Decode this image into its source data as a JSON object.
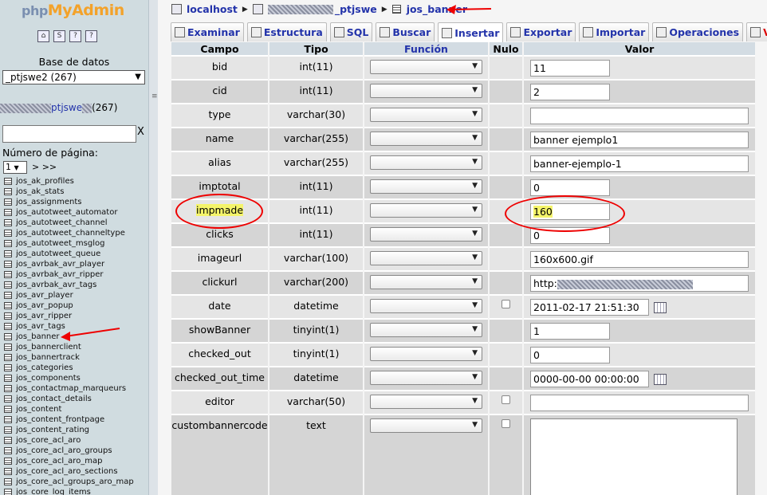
{
  "left": {
    "logo": {
      "php": "php",
      "my": "MyAdmin"
    },
    "db_label": "Base de datos",
    "db_select": "_ptjswe2 (267)",
    "db_name_visible": "ptjswe",
    "db_count": "(267)",
    "filter_clear": "X",
    "page_label": "Número de página:",
    "page_value": "1",
    "page_nav": "> >>",
    "tables": [
      "jos_ak_profiles",
      "jos_ak_stats",
      "jos_assignments",
      "jos_autotweet_automator",
      "jos_autotweet_channel",
      "jos_autotweet_channeltype",
      "jos_autotweet_msglog",
      "jos_autotweet_queue",
      "jos_avrbak_avr_player",
      "jos_avrbak_avr_ripper",
      "jos_avrbak_avr_tags",
      "jos_avr_player",
      "jos_avr_popup",
      "jos_avr_ripper",
      "jos_avr_tags",
      "jos_banner",
      "jos_bannerclient",
      "jos_bannertrack",
      "jos_categories",
      "jos_components",
      "jos_contactmap_marqueurs",
      "jos_contact_details",
      "jos_content",
      "jos_content_frontpage",
      "jos_content_rating",
      "jos_core_acl_aro",
      "jos_core_acl_aro_groups",
      "jos_core_acl_aro_map",
      "jos_core_acl_aro_sections",
      "jos_core_acl_groups_aro_map",
      "jos_core_log_items"
    ]
  },
  "breadcrumb": {
    "server": "localhost",
    "db": "_ptjswe",
    "table": "jos_banner"
  },
  "tabs": [
    {
      "label": "Examinar"
    },
    {
      "label": "Estructura"
    },
    {
      "label": "SQL"
    },
    {
      "label": "Buscar"
    },
    {
      "label": "Insertar",
      "active": true
    },
    {
      "label": "Exportar"
    },
    {
      "label": "Importar"
    },
    {
      "label": "Operaciones"
    },
    {
      "label": "Vaciar",
      "danger": true
    }
  ],
  "headers": {
    "campo": "Campo",
    "tipo": "Tipo",
    "funcion": "Función",
    "nulo": "Nulo",
    "valor": "Valor"
  },
  "rows": [
    {
      "campo": "bid",
      "tipo": "int(11)",
      "valor": "11",
      "width": "short",
      "nulo": false
    },
    {
      "campo": "cid",
      "tipo": "int(11)",
      "valor": "2",
      "width": "short",
      "nulo": false
    },
    {
      "campo": "type",
      "tipo": "varchar(30)",
      "valor": "",
      "width": "long",
      "nulo": false
    },
    {
      "campo": "name",
      "tipo": "varchar(255)",
      "valor": "banner ejemplo1",
      "width": "long",
      "nulo": false
    },
    {
      "campo": "alias",
      "tipo": "varchar(255)",
      "valor": "banner-ejemplo-1",
      "width": "long",
      "nulo": false
    },
    {
      "campo": "imptotal",
      "tipo": "int(11)",
      "valor": "0",
      "width": "short",
      "nulo": false
    },
    {
      "campo": "impmade",
      "tipo": "int(11)",
      "valor": "160",
      "width": "short",
      "nulo": false,
      "highlight": true
    },
    {
      "campo": "clicks",
      "tipo": "int(11)",
      "valor": "0",
      "width": "short",
      "nulo": false
    },
    {
      "campo": "imageurl",
      "tipo": "varchar(100)",
      "valor": "160x600.gif",
      "width": "long",
      "nulo": false
    },
    {
      "campo": "clickurl",
      "tipo": "varchar(200)",
      "valor": "http:",
      "width": "long",
      "nulo": false,
      "blurred": true
    },
    {
      "campo": "date",
      "tipo": "datetime",
      "valor": "2011-02-17 21:51:30",
      "width": "dt",
      "nulo": true,
      "calendar": true
    },
    {
      "campo": "showBanner",
      "tipo": "tinyint(1)",
      "valor": "1",
      "width": "short",
      "nulo": false
    },
    {
      "campo": "checked_out",
      "tipo": "tinyint(1)",
      "valor": "0",
      "width": "short",
      "nulo": false
    },
    {
      "campo": "checked_out_time",
      "tipo": "datetime",
      "valor": "0000-00-00 00:00:00",
      "width": "dt",
      "nulo": false,
      "calendar": true
    },
    {
      "campo": "editor",
      "tipo": "varchar(50)",
      "valor": "",
      "width": "long",
      "nulo": true
    },
    {
      "campo": "custombannercode",
      "tipo": "text",
      "valor": "",
      "width": "textarea",
      "nulo": true
    }
  ],
  "colors": {
    "link": "#2333aa",
    "annotation": "#e00000",
    "highlight": "#f4f46a"
  }
}
